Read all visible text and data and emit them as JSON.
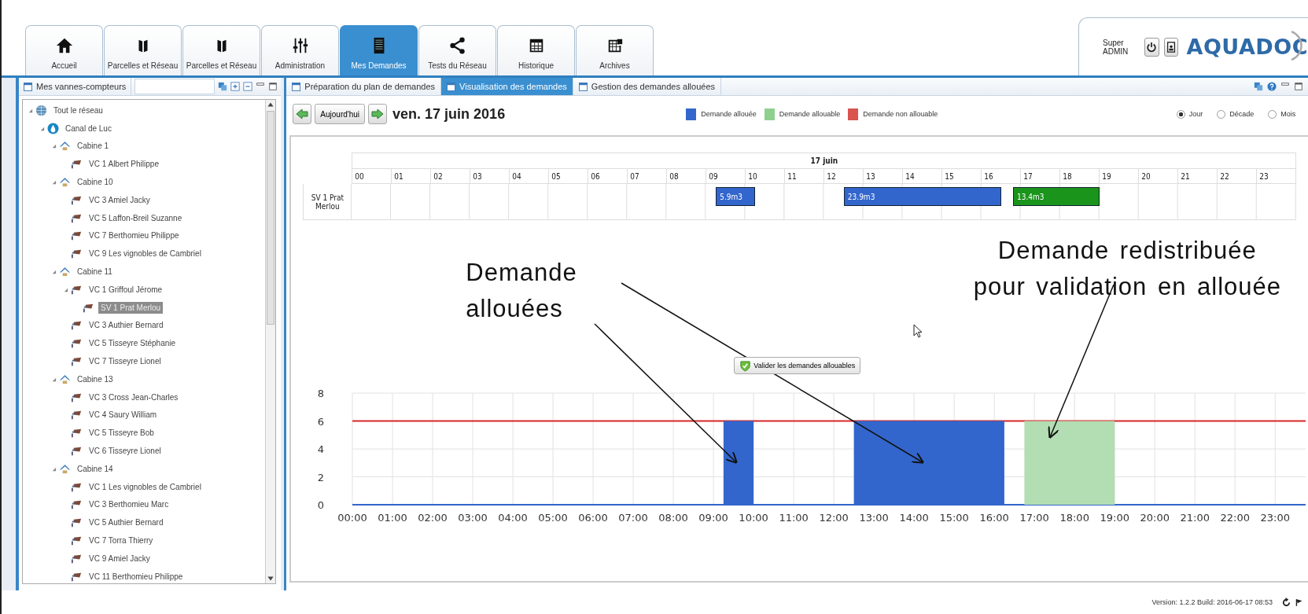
{
  "nav_tabs": [
    {
      "label": "Accueil",
      "kind": "home",
      "selected": false
    },
    {
      "label": "Parcelles et Réseau",
      "kind": "map",
      "selected": false
    },
    {
      "label": "Parcelles et Réseau",
      "kind": "map",
      "selected": false
    },
    {
      "label": "Administration",
      "kind": "sliders",
      "selected": false
    },
    {
      "label": "Mes Demandes",
      "kind": "document",
      "selected": true
    },
    {
      "label": "Tests du Réseau",
      "kind": "share",
      "selected": false
    },
    {
      "label": "Historique",
      "kind": "table",
      "selected": false
    },
    {
      "label": "Archives",
      "kind": "archive",
      "selected": false
    }
  ],
  "user": {
    "name": "Super ADMIN",
    "logo": "AQUADOC"
  },
  "left_panel": {
    "tab": "Mes vannes-compteurs"
  },
  "tree": {
    "items": [
      {
        "label": "Tout le réseau",
        "kind": "network",
        "expanded": true,
        "selected": false,
        "children": [
          {
            "label": "Canal de Luc",
            "kind": "canal",
            "expanded": true,
            "selected": false,
            "children": [
              {
                "label": "Cabine 1",
                "kind": "cabine",
                "expanded": true,
                "selected": false,
                "children": [
                  {
                    "label": "VC 1 Albert Philippe",
                    "kind": "meter",
                    "selected": false
                  }
                ]
              },
              {
                "label": "Cabine 10",
                "kind": "cabine",
                "expanded": true,
                "selected": false,
                "children": [
                  {
                    "label": "VC 3 Amiel Jacky",
                    "kind": "meter",
                    "selected": false
                  },
                  {
                    "label": "VC 5 Laffon-Breil Suzanne",
                    "kind": "meter",
                    "selected": false
                  },
                  {
                    "label": "VC 7 Berthomieu Philippe",
                    "kind": "meter",
                    "selected": false
                  },
                  {
                    "label": "VC 9 Les vignobles de Cambriel",
                    "kind": "meter",
                    "selected": false
                  }
                ]
              },
              {
                "label": "Cabine 11",
                "kind": "cabine",
                "expanded": true,
                "selected": false,
                "children": [
                  {
                    "label": "VC 1 Griffoul Jérome",
                    "kind": "meter",
                    "expanded": true,
                    "selected": false,
                    "children": [
                      {
                        "label": "SV 1 Prat Merlou",
                        "kind": "meter",
                        "selected": true
                      }
                    ]
                  },
                  {
                    "label": "VC 3 Authier Bernard",
                    "kind": "meter",
                    "selected": false
                  },
                  {
                    "label": "VC 5 Tisseyre Stéphanie",
                    "kind": "meter",
                    "selected": false
                  },
                  {
                    "label": "VC 7 Tisseyre Lionel",
                    "kind": "meter",
                    "selected": false
                  }
                ]
              },
              {
                "label": "Cabine 13",
                "kind": "cabine",
                "expanded": true,
                "selected": false,
                "children": [
                  {
                    "label": "VC 3 Cross Jean-Charles",
                    "kind": "meter",
                    "selected": false
                  },
                  {
                    "label": "VC 4 Saury William",
                    "kind": "meter",
                    "selected": false
                  },
                  {
                    "label": "VC 5 Tisseyre Bob",
                    "kind": "meter",
                    "selected": false
                  },
                  {
                    "label": "VC 6 Tisseyre Lionel",
                    "kind": "meter",
                    "selected": false
                  }
                ]
              },
              {
                "label": "Cabine 14",
                "kind": "cabine",
                "expanded": true,
                "selected": false,
                "children": [
                  {
                    "label": "VC 1 Les vignobles de Cambriel",
                    "kind": "meter",
                    "selected": false
                  },
                  {
                    "label": "VC 3 Berthomieu Marc",
                    "kind": "meter",
                    "selected": false
                  },
                  {
                    "label": "VC 5 Authier Bernard",
                    "kind": "meter",
                    "selected": false
                  },
                  {
                    "label": "VC 7 Torra Thierry",
                    "kind": "meter",
                    "selected": false
                  },
                  {
                    "label": "VC 9 Amiel Jacky",
                    "kind": "meter",
                    "selected": false
                  },
                  {
                    "label": "VC 11 Berthomieu Philippe",
                    "kind": "meter",
                    "selected": false
                  }
                ]
              }
            ]
          }
        ]
      }
    ]
  },
  "content_tabs": [
    {
      "label": "Préparation du plan de demandes",
      "selected": false
    },
    {
      "label": "Visualisation des demandes",
      "selected": true
    },
    {
      "label": "Gestion des demandes allouées",
      "selected": false
    }
  ],
  "toolbar": {
    "today_button": "Aujourd'hui",
    "date": "ven. 17 juin 2016"
  },
  "legend": [
    {
      "label": "Demande allouée",
      "color": "#3366cc"
    },
    {
      "label": "Demande allouable",
      "color": "#8fd08f"
    },
    {
      "label": "Demande non allouable",
      "color": "#d9534f"
    }
  ],
  "periods": [
    {
      "label": "Jour",
      "selected": true
    },
    {
      "label": "Décade",
      "selected": false
    },
    {
      "label": "Mois",
      "selected": false
    }
  ],
  "gantt": {
    "title": "17 juin",
    "hours": [
      "00",
      "01",
      "02",
      "03",
      "04",
      "05",
      "06",
      "07",
      "08",
      "09",
      "10",
      "11",
      "12",
      "13",
      "14",
      "15",
      "16",
      "17",
      "18",
      "19",
      "20",
      "21",
      "22",
      "23"
    ],
    "row_label": "SV 1 Prat Merlou",
    "bars": [
      {
        "text": "5.9m3",
        "color": "#3366cc"
      },
      {
        "text": "23.9m3",
        "color": "#3366cc"
      },
      {
        "text": "13.4m3",
        "color": "#1a941a"
      }
    ]
  },
  "annotations": [
    {
      "text": "Demande\nallouées"
    },
    {
      "text": "Demande redistribuée\npour validation en allouée"
    }
  ],
  "validate_button": "Valider les demandes allouables",
  "chart": {
    "chart_data": {
      "type": "area",
      "xlim": [
        0,
        23.76
      ],
      "ylim": [
        0,
        8
      ],
      "x": [
        0,
        9.25,
        9.25,
        10,
        10,
        12.5,
        12.5,
        16.25,
        16.25,
        16.75,
        16.75,
        19,
        19,
        23.76
      ],
      "grid": true,
      "xticks": [
        {
          "value": 0,
          "label": "00:00"
        },
        {
          "value": 1,
          "label": "01:00"
        },
        {
          "value": 2,
          "label": "02:00"
        },
        {
          "value": 3,
          "label": "03:00"
        },
        {
          "value": 4,
          "label": "04:00"
        },
        {
          "value": 5,
          "label": "05:00"
        },
        {
          "value": 6,
          "label": "06:00"
        },
        {
          "value": 7,
          "label": "07:00"
        },
        {
          "value": 8,
          "label": "08:00"
        },
        {
          "value": 9,
          "label": "09:00"
        },
        {
          "value": 10,
          "label": "10:00"
        },
        {
          "value": 11,
          "label": "11:00"
        },
        {
          "value": 12,
          "label": "12:00"
        },
        {
          "value": 13,
          "label": "13:00"
        },
        {
          "value": 14,
          "label": "14:00"
        },
        {
          "value": 15,
          "label": "15:00"
        },
        {
          "value": 16,
          "label": "16:00"
        },
        {
          "value": 17,
          "label": "17:00"
        },
        {
          "value": 18,
          "label": "18:00"
        },
        {
          "value": 19,
          "label": "19:00"
        },
        {
          "value": 20,
          "label": "20:00"
        },
        {
          "value": 21,
          "label": "21:00"
        },
        {
          "value": 22,
          "label": "22:00"
        },
        {
          "value": 23,
          "label": "23:00"
        }
      ],
      "yticks": [
        0,
        2,
        4,
        6,
        8
      ],
      "series": [
        {
          "color": "#3366cc",
          "values": [
            0,
            0,
            6,
            6,
            0,
            0,
            6,
            6,
            0,
            0,
            0,
            0,
            0,
            0
          ]
        },
        {
          "color": "#b3ddb3",
          "values": [
            null,
            null,
            null,
            null,
            null,
            null,
            null,
            null,
            null,
            0,
            6,
            6,
            0,
            null
          ]
        }
      ],
      "ref_lines": [
        {
          "axis": "y",
          "value": 6,
          "color": "#d62728"
        }
      ]
    }
  },
  "footer": {
    "version": "Version: 1.2.2 Build: 2016-06-17 08:53"
  }
}
